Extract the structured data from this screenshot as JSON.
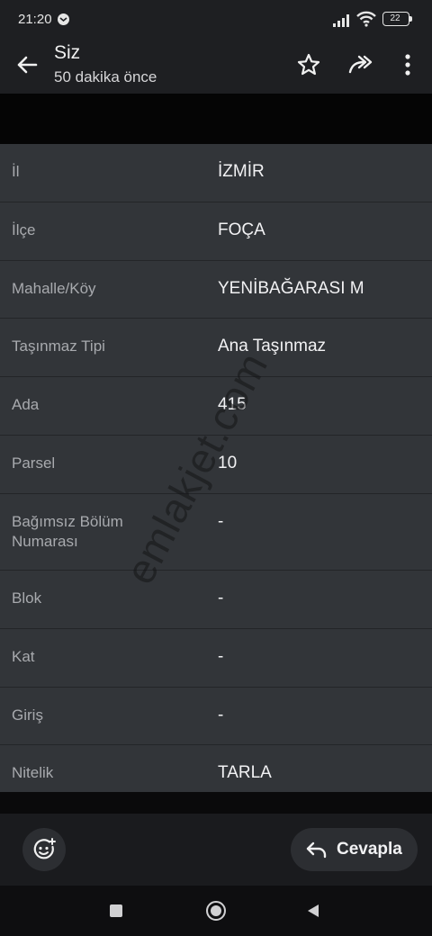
{
  "status_bar": {
    "time": "21:20",
    "battery": "22"
  },
  "header": {
    "title": "Siz",
    "subtitle": "50 dakika önce"
  },
  "icons": {
    "back": "arrow-left-icon",
    "star": "star-icon",
    "forward": "forward-icon",
    "menu": "more-vert-icon",
    "emoji": "emoji-add-icon",
    "reply": "reply-icon"
  },
  "rows": [
    {
      "label": "İl",
      "value": "İZMİR"
    },
    {
      "label": "İlçe",
      "value": "FOÇA"
    },
    {
      "label": "Mahalle/Köy",
      "value": "YENİBAĞARASI M"
    },
    {
      "label": "Taşınmaz Tipi",
      "value": "Ana Taşınmaz"
    },
    {
      "label": "Ada",
      "value": "415"
    },
    {
      "label": "Parsel",
      "value": "10"
    },
    {
      "label": "Bağımsız Bölüm Numarası",
      "value": "-"
    },
    {
      "label": "Blok",
      "value": "-"
    },
    {
      "label": "Kat",
      "value": "-"
    },
    {
      "label": "Giriş",
      "value": "-"
    },
    {
      "label": "Nitelik",
      "value": "TARLA"
    }
  ],
  "watermark": "emlakjet.com",
  "actions": {
    "reply_label": "Cevapla"
  },
  "colors": {
    "background": "#1c1d20",
    "table": "#323539",
    "label": "#a8aaae",
    "value": "#f2f2f4"
  }
}
